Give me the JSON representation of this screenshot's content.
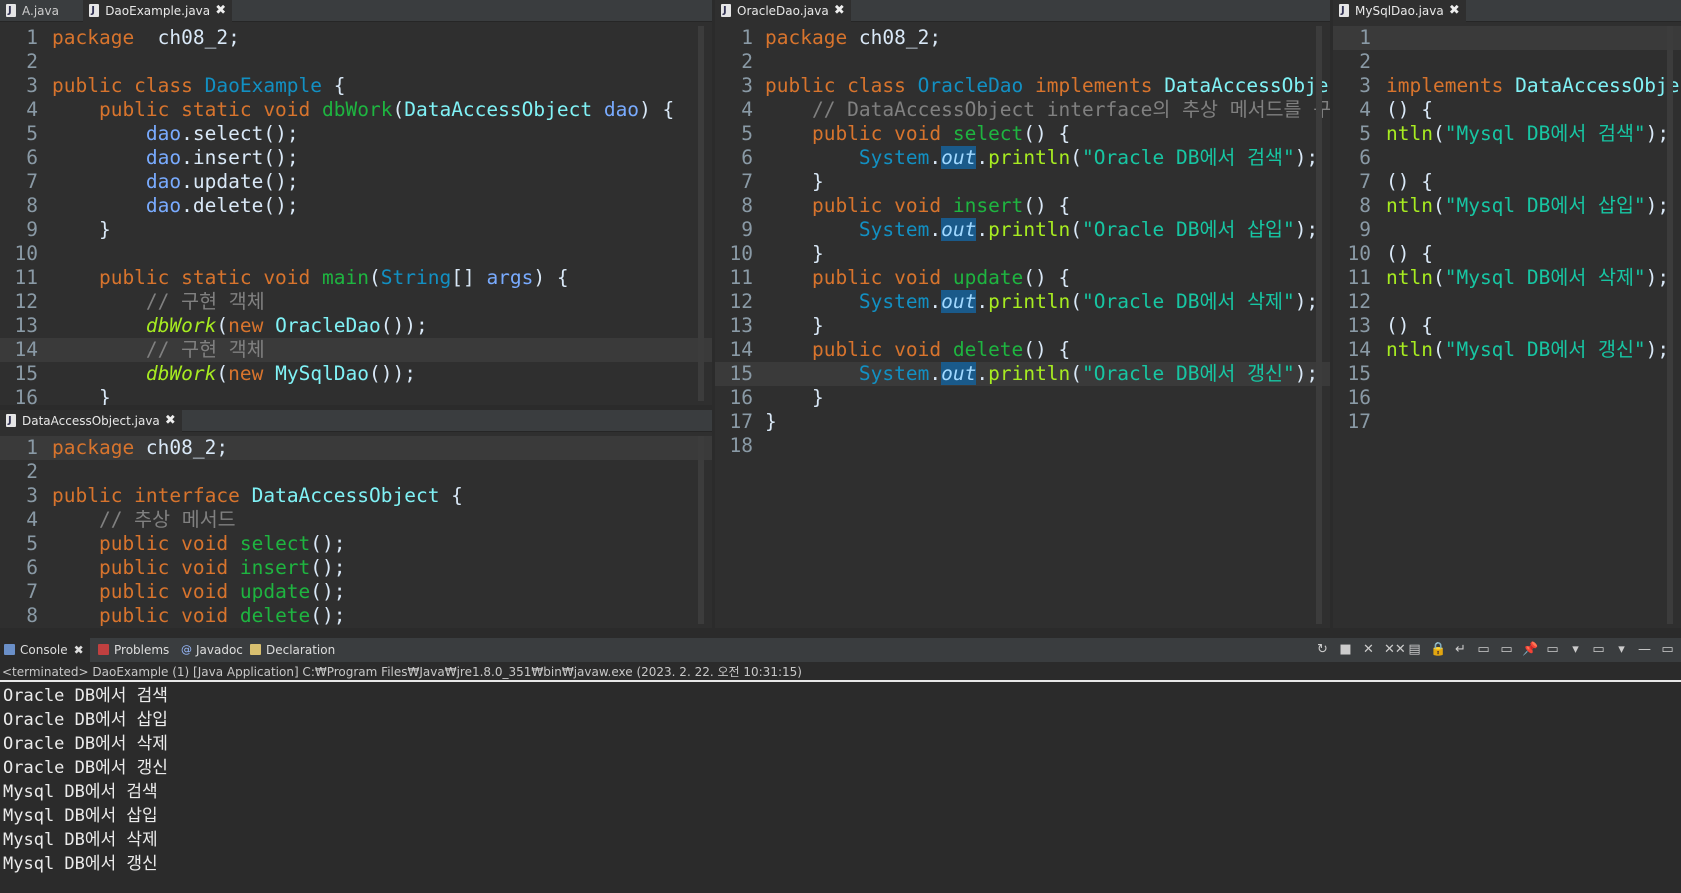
{
  "editors": [
    {
      "id": "dao-example",
      "tabs": [
        {
          "label": "A.java",
          "active": false
        },
        {
          "label": "DaoExample.java",
          "active": true,
          "close": "✖"
        }
      ],
      "lines": [
        [
          [
            "kw",
            "package"
          ],
          [
            "",
            "  ch08_2;"
          ]
        ],
        [],
        [
          [
            "kw",
            "public class "
          ],
          [
            "cls",
            "DaoExample"
          ],
          [
            "",
            " {"
          ]
        ],
        [
          [
            "kw",
            "    public static void "
          ],
          [
            "mth",
            "dbWork"
          ],
          [
            "",
            "("
          ],
          [
            "ifc",
            "DataAccessObject"
          ],
          [
            "",
            " "
          ],
          [
            "var",
            "dao"
          ],
          [
            "",
            ") {"
          ]
        ],
        [
          [
            "",
            "        "
          ],
          [
            "var",
            "dao"
          ],
          [
            "",
            ".select();"
          ]
        ],
        [
          [
            "",
            "        "
          ],
          [
            "var",
            "dao"
          ],
          [
            "",
            ".insert();"
          ]
        ],
        [
          [
            "",
            "        "
          ],
          [
            "var",
            "dao"
          ],
          [
            "",
            ".update();"
          ]
        ],
        [
          [
            "",
            "        "
          ],
          [
            "var",
            "dao"
          ],
          [
            "",
            ".delete();"
          ]
        ],
        [
          [
            "",
            "    }"
          ]
        ],
        [],
        [
          [
            "kw",
            "    public static void "
          ],
          [
            "mth",
            "main"
          ],
          [
            "",
            "("
          ],
          [
            "cls",
            "String"
          ],
          [
            "",
            "[] "
          ],
          [
            "var",
            "args"
          ],
          [
            "",
            ") {"
          ]
        ],
        [
          [
            "cmt",
            "        // 구현 객체"
          ]
        ],
        [
          [
            "",
            "        "
          ],
          [
            "stat",
            "dbWork"
          ],
          [
            "",
            "("
          ],
          [
            "kw",
            "new "
          ],
          [
            "ifc",
            "OracleDao"
          ],
          [
            "",
            "());"
          ]
        ],
        [
          [
            "cmt",
            "        // 구현 객체"
          ]
        ],
        [
          [
            "",
            "        "
          ],
          [
            "stat",
            "dbWork"
          ],
          [
            "",
            "("
          ],
          [
            "kw",
            "new "
          ],
          [
            "ifc",
            "MySqlDao"
          ],
          [
            "",
            "());"
          ]
        ],
        [
          [
            "",
            "    }"
          ]
        ]
      ],
      "current": 14
    },
    {
      "id": "data-access-object",
      "tabs": [
        {
          "label": "DataAccessObject.java",
          "active": true,
          "close": "✖"
        }
      ],
      "lines": [
        [
          [
            "kw",
            "package"
          ],
          [
            "",
            " ch08_2;"
          ]
        ],
        [],
        [
          [
            "kw",
            "public interface "
          ],
          [
            "ifc",
            "DataAccessObject"
          ],
          [
            "",
            " {"
          ]
        ],
        [
          [
            "cmt",
            "    // 추상 메서드"
          ]
        ],
        [
          [
            "kw",
            "    public void "
          ],
          [
            "mth",
            "select"
          ],
          [
            "",
            "();"
          ]
        ],
        [
          [
            "kw",
            "    public void "
          ],
          [
            "mth",
            "insert"
          ],
          [
            "",
            "();"
          ]
        ],
        [
          [
            "kw",
            "    public void "
          ],
          [
            "mth",
            "update"
          ],
          [
            "",
            "();"
          ]
        ],
        [
          [
            "kw",
            "    public void "
          ],
          [
            "mth",
            "delete"
          ],
          [
            "",
            "();"
          ]
        ]
      ],
      "current": 1
    },
    {
      "id": "oracle-dao",
      "tabs": [
        {
          "label": "OracleDao.java",
          "active": true,
          "close": "✖"
        }
      ],
      "lines": [
        [
          [
            "kw",
            "package"
          ],
          [
            "",
            " ch08_2;"
          ]
        ],
        [],
        [
          [
            "kw",
            "public class "
          ],
          [
            "cls",
            "OracleDao"
          ],
          [
            "kw",
            " implements "
          ],
          [
            "ifc",
            "DataAccessObject"
          ],
          [
            "",
            " {"
          ]
        ],
        [
          [
            "cmt",
            "    // DataAccessObject interface의 추상 메서드를 구현"
          ]
        ],
        [
          [
            "kw",
            "    public void "
          ],
          [
            "mth",
            "select"
          ],
          [
            "",
            "() {"
          ]
        ],
        [
          [
            "",
            "        "
          ],
          [
            "cls",
            "System"
          ],
          [
            "",
            "."
          ],
          [
            "out",
            "out"
          ],
          [
            "",
            "."
          ],
          [
            "call",
            "println"
          ],
          [
            "",
            "("
          ],
          [
            "str",
            "\"Oracle DB에서 검색\""
          ],
          [
            "",
            ");"
          ]
        ],
        [
          [
            "",
            "    }"
          ]
        ],
        [
          [
            "kw",
            "    public void "
          ],
          [
            "mth",
            "insert"
          ],
          [
            "",
            "() {"
          ]
        ],
        [
          [
            "",
            "        "
          ],
          [
            "cls",
            "System"
          ],
          [
            "",
            "."
          ],
          [
            "out",
            "out"
          ],
          [
            "",
            "."
          ],
          [
            "call",
            "println"
          ],
          [
            "",
            "("
          ],
          [
            "str",
            "\"Oracle DB에서 삽입\""
          ],
          [
            "",
            ");"
          ]
        ],
        [
          [
            "",
            "    }"
          ]
        ],
        [
          [
            "kw",
            "    public void "
          ],
          [
            "mth",
            "update"
          ],
          [
            "",
            "() {"
          ]
        ],
        [
          [
            "",
            "        "
          ],
          [
            "cls",
            "System"
          ],
          [
            "",
            "."
          ],
          [
            "out",
            "out"
          ],
          [
            "",
            "."
          ],
          [
            "call",
            "println"
          ],
          [
            "",
            "("
          ],
          [
            "str",
            "\"Oracle DB에서 삭제\""
          ],
          [
            "",
            ");"
          ]
        ],
        [
          [
            "",
            "    }"
          ]
        ],
        [
          [
            "kw",
            "    public void "
          ],
          [
            "mth",
            "delete"
          ],
          [
            "",
            "() {"
          ]
        ],
        [
          [
            "",
            "        "
          ],
          [
            "cls",
            "System"
          ],
          [
            "",
            "."
          ],
          [
            "out",
            "out"
          ],
          [
            "",
            "."
          ],
          [
            "call",
            "println"
          ],
          [
            "",
            "("
          ],
          [
            "str",
            "\"Oracle DB에서 갱신\""
          ],
          [
            "",
            ");"
          ]
        ],
        [
          [
            "",
            "    }"
          ]
        ],
        [
          [
            "",
            "}"
          ]
        ],
        []
      ],
      "current": 15
    },
    {
      "id": "mysql-dao",
      "tabs": [
        {
          "label": "MySqlDao.java",
          "active": true,
          "close": "✖"
        }
      ],
      "lines": [
        [],
        [],
        [
          [
            "kw",
            "implements "
          ],
          [
            "ifc",
            "DataAccessObject"
          ],
          [
            "",
            " {"
          ]
        ],
        [
          [
            "",
            "() {"
          ]
        ],
        [
          [
            "call",
            "ntln"
          ],
          [
            "",
            "("
          ],
          [
            "str",
            "\"Mysql DB에서 검색\""
          ],
          [
            "",
            ");"
          ]
        ],
        [],
        [
          [
            "",
            "() {"
          ]
        ],
        [
          [
            "call",
            "ntln"
          ],
          [
            "",
            "("
          ],
          [
            "str",
            "\"Mysql DB에서 삽입\""
          ],
          [
            "",
            ");"
          ]
        ],
        [],
        [
          [
            "",
            "() {"
          ]
        ],
        [
          [
            "call",
            "ntln"
          ],
          [
            "",
            "("
          ],
          [
            "str",
            "\"Mysql DB에서 삭제\""
          ],
          [
            "",
            ");"
          ]
        ],
        [],
        [
          [
            "",
            "() {"
          ]
        ],
        [
          [
            "call",
            "ntln"
          ],
          [
            "",
            "("
          ],
          [
            "str",
            "\"Mysql DB에서 갱신\""
          ],
          [
            "",
            ");"
          ]
        ],
        [],
        [],
        []
      ],
      "current": 1
    }
  ],
  "console": {
    "tabs": [
      {
        "label": "Console",
        "close": "✖"
      },
      {
        "label": "Problems"
      },
      {
        "label": "Javadoc"
      },
      {
        "label": "Declaration"
      }
    ],
    "toolbar": [
      "↻",
      "■",
      "✕",
      "✕✕",
      "▤",
      "🔒",
      "↵",
      "▭",
      "▭",
      "📌",
      "▭",
      "▾",
      "▭",
      "▾",
      "—",
      "▭"
    ],
    "status": "<terminated> DaoExample (1) [Java Application] C:₩Program Files₩Java₩jre1.8.0_351₩bin₩javaw.exe (2023. 2. 22. 오전 10:31:15)",
    "output": [
      "Oracle DB에서 검색",
      "Oracle DB에서 삽입",
      "Oracle DB에서 삭제",
      "Oracle DB에서 갱신",
      "Mysql DB에서 검색",
      "Mysql DB에서 삽입",
      "Mysql DB에서 삭제",
      "Mysql DB에서 갱신"
    ]
  }
}
